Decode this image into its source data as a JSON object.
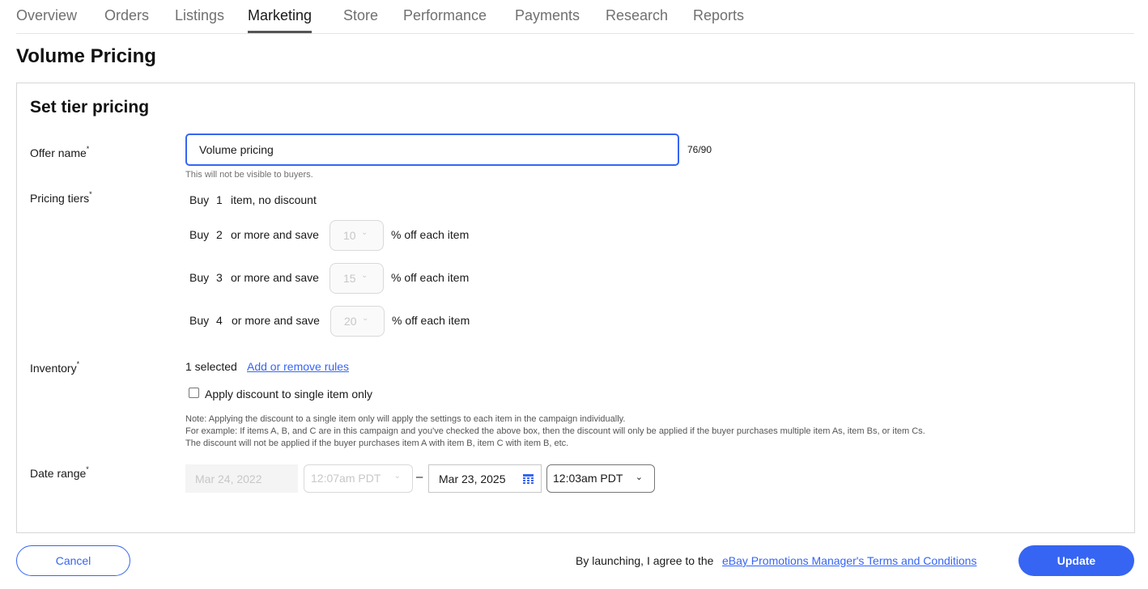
{
  "nav": {
    "tabs": [
      {
        "label": "Overview",
        "active": false
      },
      {
        "label": "Orders",
        "active": false
      },
      {
        "label": "Listings",
        "active": false
      },
      {
        "label": "Marketing",
        "active": true
      },
      {
        "label": "Store",
        "active": false
      },
      {
        "label": "Performance",
        "active": false
      },
      {
        "label": "Payments",
        "active": false
      },
      {
        "label": "Research",
        "active": false
      },
      {
        "label": "Reports",
        "active": false
      }
    ]
  },
  "page_title": "Volume Pricing",
  "card": {
    "title": "Set tier pricing",
    "offer_name": {
      "label": "Offer name",
      "required_mark": "*",
      "value": "Volume pricing",
      "char_count": "76/90",
      "helper": "This will not be visible to buyers."
    },
    "pricing_tiers": {
      "label": "Pricing tiers",
      "required_mark": "*",
      "base": {
        "buy": "Buy",
        "qty": "1",
        "text": "item, no discount"
      },
      "tiers": [
        {
          "buy": "Buy",
          "qty": "2",
          "text": "or more and save",
          "discount": "10",
          "suffix": "% off each item"
        },
        {
          "buy": "Buy",
          "qty": "3",
          "text": "or more and save",
          "discount": "15",
          "suffix": "% off each item"
        },
        {
          "buy": "Buy",
          "qty": "4",
          "text": "or more and save",
          "discount": "20",
          "suffix": "% off each item"
        }
      ]
    },
    "inventory": {
      "label": "Inventory",
      "required_mark": "*",
      "selected": "1 selected",
      "link": "Add or remove rules",
      "checkbox_label": "Apply discount to single item only",
      "checkbox_checked": false,
      "note": [
        "Note: Applying the discount to a single item only will apply the settings to each item in the campaign individually.",
        "For example: If items A, B, and C are in this campaign and you've checked the above box, then the discount will only be applied if the buyer purchases multiple item As, item Bs, or item Cs.",
        "The discount will not be applied if the buyer purchases item A with item B, item C with item B, etc."
      ]
    },
    "date_range": {
      "label": "Date range",
      "required_mark": "*",
      "start_date": "Mar 24, 2022",
      "start_time": "12:07am PDT",
      "separator": "–",
      "end_date": "Mar 23, 2025",
      "end_time": "12:03am PDT"
    }
  },
  "footer": {
    "cancel_label": "Cancel",
    "agree_text": "By launching, I agree to the",
    "terms_link": "eBay Promotions Manager's Terms and Conditions",
    "update_label": "Update"
  },
  "colors": {
    "accent": "#3665f3",
    "text": "#191919",
    "muted": "#707070"
  }
}
